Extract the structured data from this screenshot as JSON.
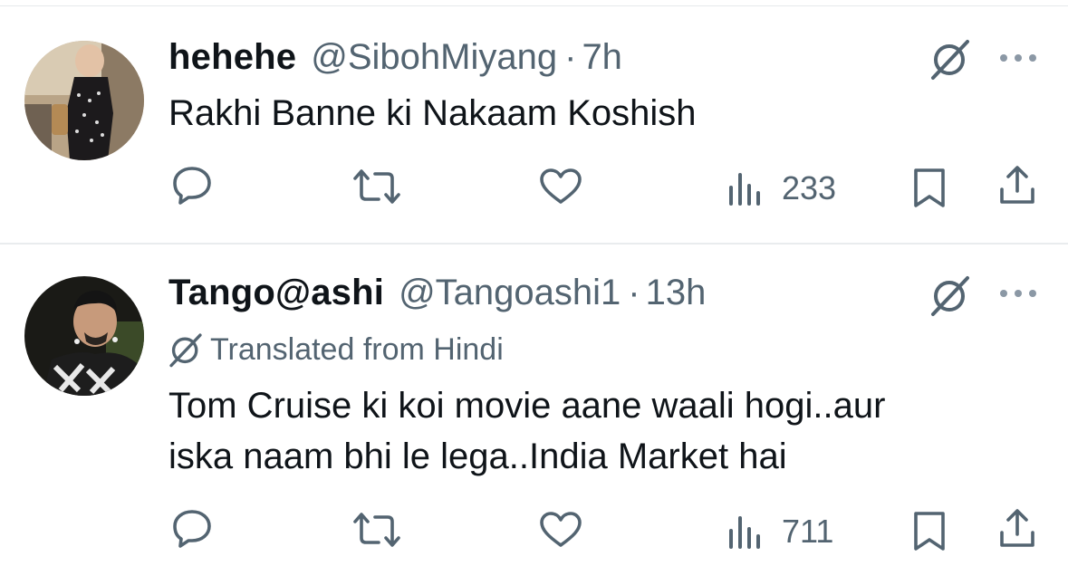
{
  "tweets": [
    {
      "display_name": "hehehe",
      "handle": "@SibohMiyang",
      "separator": "·",
      "time": "7h",
      "text_lines": [
        "Rakhi Banne ki Nakaam Koshish"
      ],
      "views": "233",
      "icons": [
        "reply-icon",
        "retweet-icon",
        "like-icon",
        "views-icon",
        "bookmark-icon",
        "share-icon"
      ]
    },
    {
      "display_name": "Tango@ashi",
      "handle": "@Tangoashi1",
      "separator": "·",
      "time": "13h",
      "translated_label": "Translated from Hindi",
      "text_lines": [
        "Tom Cruise ki koi movie aane waali hogi..aur",
        "iska naam bhi le lega..India Market hai"
      ],
      "views": "711",
      "icons": [
        "reply-icon",
        "retweet-icon",
        "like-icon",
        "views-icon",
        "bookmark-icon",
        "share-icon"
      ]
    }
  ],
  "colors": {
    "text": "#0f1419",
    "secondary": "#536471",
    "divider": "#e9ecee"
  }
}
